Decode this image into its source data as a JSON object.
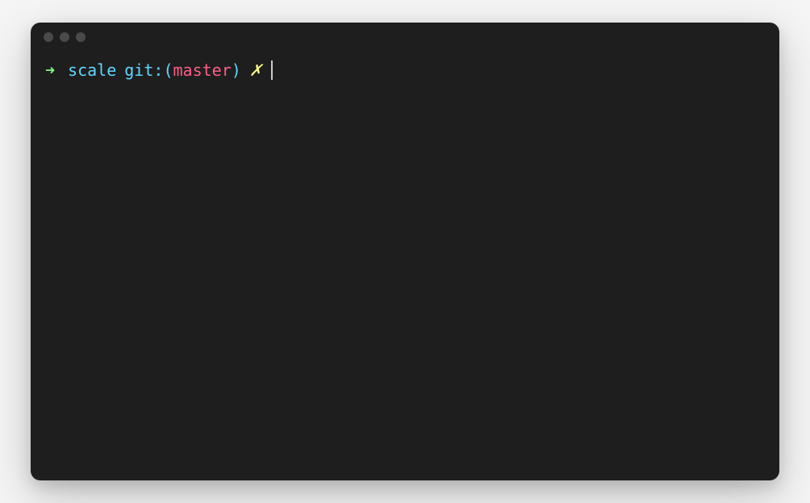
{
  "prompt": {
    "arrow": "➜",
    "directory": "scale",
    "git_label": "git:",
    "git_paren_open": "(",
    "git_branch": "master",
    "git_paren_close": ")",
    "dirty_marker": "✗"
  }
}
